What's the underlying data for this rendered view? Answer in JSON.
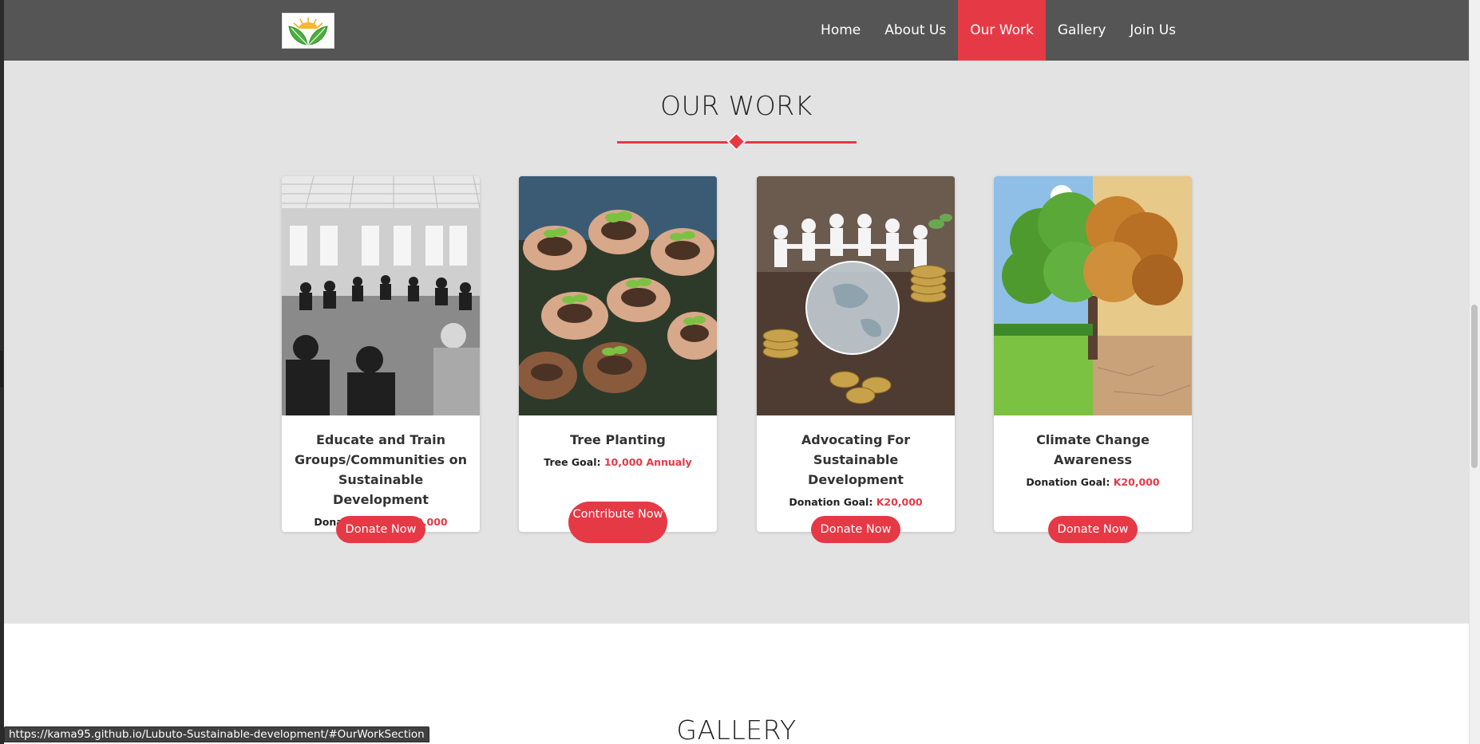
{
  "nav": {
    "items": [
      {
        "label": "Home",
        "active": false
      },
      {
        "label": "About Us",
        "active": false
      },
      {
        "label": "Our Work",
        "active": true
      },
      {
        "label": "Gallery",
        "active": false
      },
      {
        "label": "Join Us",
        "active": false
      }
    ],
    "logo_icon": "leaves-sun-logo"
  },
  "our_work": {
    "title": "OUR WORK",
    "cards": [
      {
        "title": "Educate and Train Groups/Communities on Sustainable Development",
        "goal_label": "Donation Goal:",
        "goal_value": "K20,000",
        "button": "Donate Now",
        "image": "people-meeting-circle-photo"
      },
      {
        "title": "Tree Planting",
        "goal_label": "Tree Goal:",
        "goal_value": "10,000 Annualy",
        "button": "Contribute Now",
        "image": "hands-holding-seedlings-photo"
      },
      {
        "title": "Advocating For Sustainable Development",
        "goal_label": "Donation Goal:",
        "goal_value": "K20,000",
        "button": "Donate Now",
        "image": "globe-coins-paper-people-photo"
      },
      {
        "title": "Climate Change Awareness",
        "goal_label": "Donation Goal:",
        "goal_value": "K20,000",
        "button": "Donate Now",
        "image": "green-dry-tree-split-photo"
      }
    ]
  },
  "gallery": {
    "title": "GALLERY"
  },
  "status_url": "https://kama95.github.io/Lubuto-Sustainable-development/#OurWorkSection",
  "colors": {
    "accent": "#e63946",
    "navbar": "#555555",
    "section_bg": "#e3e3e3"
  }
}
